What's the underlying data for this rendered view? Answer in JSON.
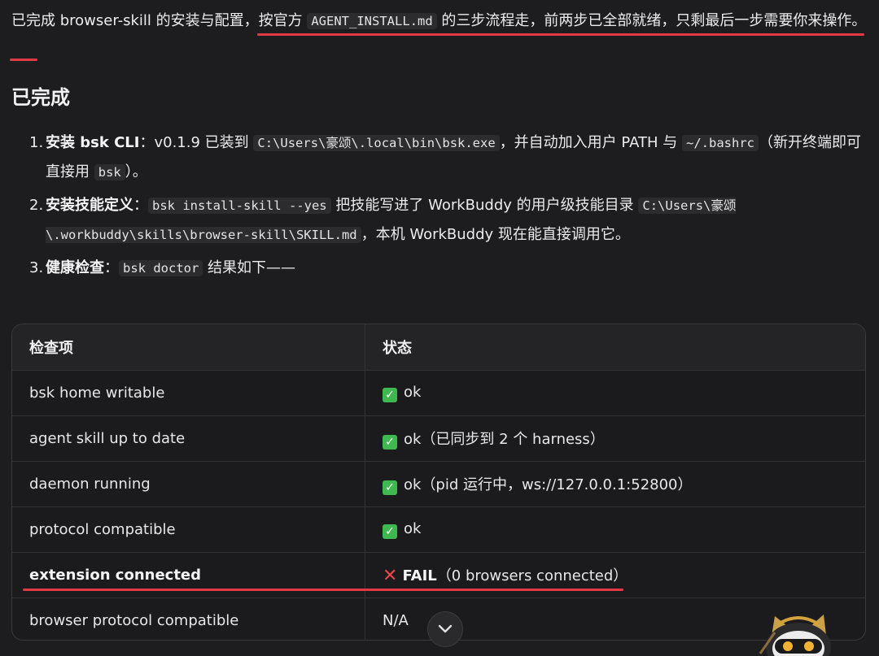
{
  "intro": {
    "part1": "已完成 browser-skill 的安装与配置，",
    "part2": "按官方 ",
    "code": "AGENT_INSTALL.md",
    "part3": " 的三步流程走，前两步已全部就绪，只剩最后一步需要你来操作。"
  },
  "heading": "已完成",
  "steps": [
    {
      "num": "1.",
      "title": "安装 bsk CLI",
      "t1": "：v0.1.9 已装到 ",
      "c1": "C:\\Users\\豪颂\\.local\\bin\\bsk.exe",
      "t2": "，并自动加入用户 PATH 与 ",
      "c2": "~/.bashrc",
      "t3": "（新开终端即可直接用 ",
      "c3": "bsk",
      "t4": "）。"
    },
    {
      "num": "2.",
      "title": "安装技能定义",
      "t1": "：",
      "c1": "bsk install-skill --yes",
      "t2": " 把技能写进了 WorkBuddy 的用户级技能目录 ",
      "c2": "C:\\Users\\豪颂\\.workbuddy\\skills\\browser-skill\\SKILL.md",
      "t3": "，本机 WorkBuddy 现在能直接调用它。"
    },
    {
      "num": "3.",
      "title": "健康检查",
      "t1": "：",
      "c1": "bsk doctor",
      "t2": " 结果如下——"
    }
  ],
  "table": {
    "headers": [
      "检查项",
      "状态"
    ],
    "rows": [
      {
        "item": "bsk home writable",
        "status": "ok",
        "note": ""
      },
      {
        "item": "agent skill up to date",
        "status": "ok",
        "note": "（已同步到 2 个 harness）"
      },
      {
        "item": "daemon running",
        "status": "ok",
        "note": "（pid 运行中，ws://127.0.0.1:52800）"
      },
      {
        "item": "protocol compatible",
        "status": "ok",
        "note": ""
      },
      {
        "item": "extension connected",
        "status": "FAIL",
        "note": "（0 browsers connected）"
      },
      {
        "item": "browser protocol compatible",
        "status": "N/A",
        "note": ""
      }
    ]
  },
  "colors": {
    "background": "#1d1d1f",
    "accent_red": "#e23a45",
    "ok_green": "#3fb94f",
    "fail_red": "#e5484d"
  },
  "icons": {
    "ok": "check-box-icon",
    "fail": "cross-icon",
    "scroll": "chevron-down-icon",
    "mascot": "cat-mascot-icon"
  }
}
